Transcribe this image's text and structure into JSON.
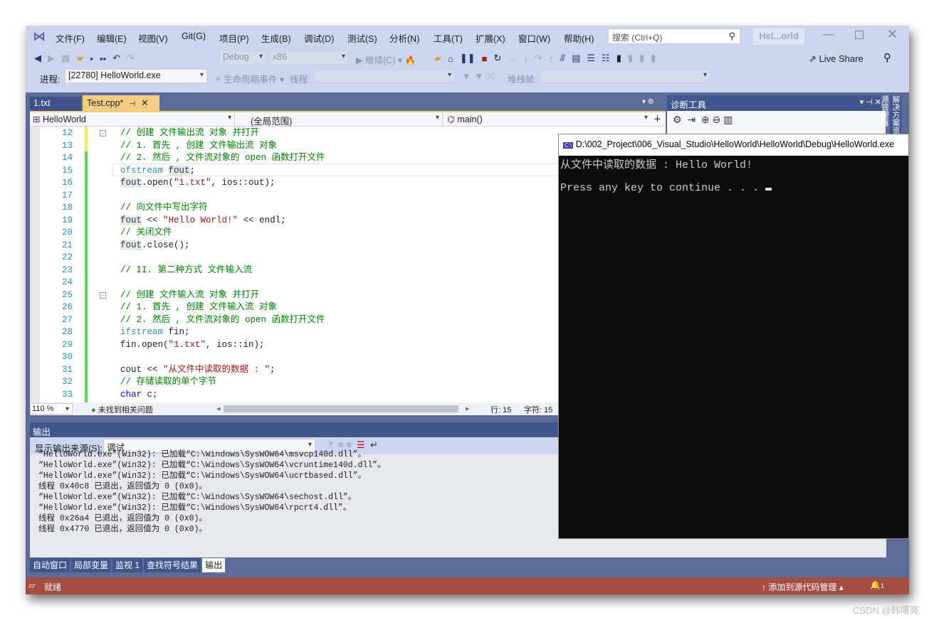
{
  "menu": [
    "文件(F)",
    "编辑(E)",
    "视图(V)",
    "Git(G)",
    "项目(P)",
    "生成(B)",
    "调试(D)",
    "测试(S)",
    "分析(N)",
    "工具(T)",
    "扩展(X)",
    "窗口(W)",
    "帮助(H)"
  ],
  "search_placeholder": "搜索 (Ctrl+Q)",
  "solution_name": "Hel...orld",
  "toolbar": {
    "config": "Debug",
    "platform": "x86",
    "continue": "继续(C)",
    "live_share": "Live Share"
  },
  "debug_bar": {
    "process_label": "进程:",
    "process": "[22780] HelloWorld.exe",
    "lifecycle": "生命周期事件",
    "thread_label": "线程:",
    "stack_label": "堆栈帧:"
  },
  "tabs": [
    {
      "label": "1.txt"
    },
    {
      "label": "Test.cpp*",
      "active": true
    }
  ],
  "nav": {
    "project": "HelloWorld",
    "scope": "(全局范围)",
    "member": "main()"
  },
  "code": [
    {
      "n": "12",
      "tokens": [
        [
          "// 创建 文件输出流 对象 并打开",
          "c"
        ]
      ]
    },
    {
      "n": "13",
      "tokens": [
        [
          "// 1. 首先 , 创建 文件输出流 对象",
          "c"
        ]
      ]
    },
    {
      "n": "14",
      "tokens": [
        [
          "// 2. 然后 , 文件流对象的 open 函数打开文件",
          "c"
        ]
      ]
    },
    {
      "n": "15",
      "tokens": [
        [
          "ofstream",
          "t"
        ],
        [
          " ",
          "p"
        ],
        [
          "fout",
          "v"
        ],
        [
          ";",
          "p"
        ]
      ]
    },
    {
      "n": "16",
      "tokens": [
        [
          "fout",
          "v"
        ],
        [
          ".open(",
          "p"
        ],
        [
          "\"1.txt\"",
          "s"
        ],
        [
          ", ios::out);",
          "p"
        ]
      ]
    },
    {
      "n": "17",
      "tokens": []
    },
    {
      "n": "18",
      "tokens": [
        [
          "// 向文件中写出字符",
          "c"
        ]
      ]
    },
    {
      "n": "19",
      "tokens": [
        [
          "fout",
          "v"
        ],
        [
          " << ",
          "p"
        ],
        [
          "\"Hello World!\"",
          "s"
        ],
        [
          " << endl;",
          "p"
        ]
      ]
    },
    {
      "n": "20",
      "tokens": [
        [
          "// 关闭文件",
          "c"
        ]
      ]
    },
    {
      "n": "21",
      "tokens": [
        [
          "fout",
          "v"
        ],
        [
          ".close();",
          "p"
        ]
      ]
    },
    {
      "n": "22",
      "tokens": []
    },
    {
      "n": "23",
      "tokens": [
        [
          "// II. 第二种方式 文件输入流",
          "c"
        ]
      ]
    },
    {
      "n": "24",
      "tokens": []
    },
    {
      "n": "25",
      "tokens": [
        [
          "// 创建 文件输入流 对象 并打开",
          "c"
        ]
      ]
    },
    {
      "n": "26",
      "tokens": [
        [
          "// 1. 首先 , 创建 文件输入流 对象",
          "c"
        ]
      ]
    },
    {
      "n": "27",
      "tokens": [
        [
          "// 2. 然后 , 文件流对象的 open 函数打开文件",
          "c"
        ]
      ]
    },
    {
      "n": "28",
      "tokens": [
        [
          "ifstream",
          "t"
        ],
        [
          " fin;",
          "p"
        ]
      ]
    },
    {
      "n": "29",
      "tokens": [
        [
          "fin.open(",
          "p"
        ],
        [
          "\"1.txt\"",
          "s"
        ],
        [
          ", ios::in);",
          "p"
        ]
      ]
    },
    {
      "n": "30",
      "tokens": []
    },
    {
      "n": "31",
      "tokens": [
        [
          "cout << ",
          "p"
        ],
        [
          "\"从文件中读取的数据 : \"",
          "s"
        ],
        [
          ";",
          "p"
        ]
      ]
    },
    {
      "n": "32",
      "tokens": [
        [
          "// 存储读取的单个字节",
          "c"
        ]
      ]
    },
    {
      "n": "33",
      "tokens": [
        [
          "char",
          "k"
        ],
        [
          " c;",
          "p"
        ]
      ]
    }
  ],
  "editor_status": {
    "zoom": "110 %",
    "issues": "未找到相关问题",
    "line": "行: 15",
    "char": "字符: 15"
  },
  "diagnostics_title": "诊断工具",
  "solution_explorer_tab": "解决方案资源管理器",
  "output": {
    "title": "输出",
    "source_label": "显示输出来源(S):",
    "source": "调试",
    "lines": [
      "“HelloWorld.exe”(Win32): 已加载“C:\\Windows\\SysWOW64\\msvcp140d.dll”。",
      "“HelloWorld.exe”(Win32): 已加载“C:\\Windows\\SysWOW64\\vcruntime140d.dll”。",
      "“HelloWorld.exe”(Win32): 已加载“C:\\Windows\\SysWOW64\\ucrtbased.dll”。",
      "线程 0x40c8 已退出，返回值为 0 (0x0)。",
      "“HelloWorld.exe”(Win32): 已加载“C:\\Windows\\SysWOW64\\sechost.dll”。",
      "“HelloWorld.exe”(Win32): 已加载“C:\\Windows\\SysWOW64\\rpcrt4.dll”。",
      "线程 0x26a4 已退出，返回值为 0 (0x0)。",
      "线程 0x4770 已退出，返回值为 0 (0x0)。"
    ]
  },
  "bottom_tabs": [
    "自动窗口",
    "局部变量",
    "监视 1",
    "查找符号结果",
    "输出"
  ],
  "statusbar": {
    "ready": "就绪",
    "source_control": "添加到源代码管理",
    "notifications": "1"
  },
  "console": {
    "title": "D:\\002_Project\\006_Visual_Studio\\HelloWorld\\HelloWorld\\Debug\\HelloWorld.exe",
    "line1": "从文件中读取的数据 : Hello World!",
    "line2": "Press any key to continue . . . "
  },
  "watermark": "CSDN @韩曙亮",
  "colors": {
    "menubar": "#ccd5f0",
    "dock": "#5d6b99",
    "statusbar": "#a54d42",
    "active_tab": "#f5cc84",
    "console_bg": "#0c0c0c"
  }
}
